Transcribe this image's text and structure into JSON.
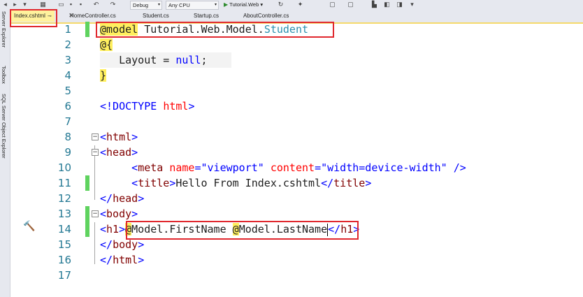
{
  "toolbar": {
    "config": "Debug",
    "platform": "Any CPU",
    "run_target": "Tutorial.Web"
  },
  "tabs": [
    {
      "label": "Index.cshtml",
      "active": true
    },
    {
      "label": "HomeController.cs"
    },
    {
      "label": "Student.cs"
    },
    {
      "label": "Startup.cs"
    },
    {
      "label": "AboutController.cs"
    }
  ],
  "side_panels": [
    "Server Explorer",
    "Toolbox",
    "SQL Server Object Explorer"
  ],
  "editor": {
    "line_numbers": [
      "1",
      "2",
      "3",
      "4",
      "5",
      "6",
      "7",
      "8",
      "9",
      "10",
      "11",
      "12",
      "13",
      "14",
      "15",
      "16",
      "17"
    ],
    "tokens": {
      "l1_model_kw": "@model",
      "l1_model_path": "Tutorial.Web.Model.",
      "l1_model_type": "Student",
      "l2_code_open": "@{",
      "l3_layout": "Layout",
      "l3_eq": " = ",
      "l3_null": "null",
      "l3_semi": ";",
      "l4_code_close": "}",
      "l6_doctype": "<!DOCTYPE",
      "l6_html": "html",
      "l6_close": ">",
      "l8_html_open": "<",
      "l8_html": "html",
      "l8_gt": ">",
      "l9_lt": "<",
      "l9_head": "head",
      "l9_gt": ">",
      "l10_lt": "<",
      "l10_meta": "meta",
      "l10_name_attr": "name",
      "l10_eq1": "=",
      "l10_name_val": "\"viewport\"",
      "l10_content_attr": "content",
      "l10_eq2": "=",
      "l10_content_val": "\"width=device-width\"",
      "l10_selfclose": "/>",
      "l11_lt": "<",
      "l11_title": "title",
      "l11_gt": ">",
      "l11_text": "Hello From Index.cshtml",
      "l11_close_lt": "</",
      "l11_close_title": "title",
      "l11_close_gt": ">",
      "l12_lt": "</",
      "l12_head": "head",
      "l12_gt": ">",
      "l13_lt": "<",
      "l13_body": "body",
      "l13_gt": ">",
      "l14_lt": "<",
      "l14_h1": "h1",
      "l14_gt": ">",
      "l14_at1": "@",
      "l14_firstname": "Model.FirstName",
      "l14_space": " ",
      "l14_at2": "@",
      "l14_lastname": "Model.LastName",
      "l14_close_lt": "</",
      "l14_close_h1": "h1",
      "l14_close_gt": ">",
      "l15_lt": "</",
      "l15_body": "body",
      "l15_gt": ">",
      "l16_lt": "</",
      "l16_html": "html",
      "l16_gt": ">"
    }
  },
  "colors": {
    "line_number": "#237893",
    "razor_highlight": "#ffef5e",
    "change_bar": "#5fd35f",
    "annotation_red": "#e0282e",
    "active_tab": "#fff29d"
  }
}
